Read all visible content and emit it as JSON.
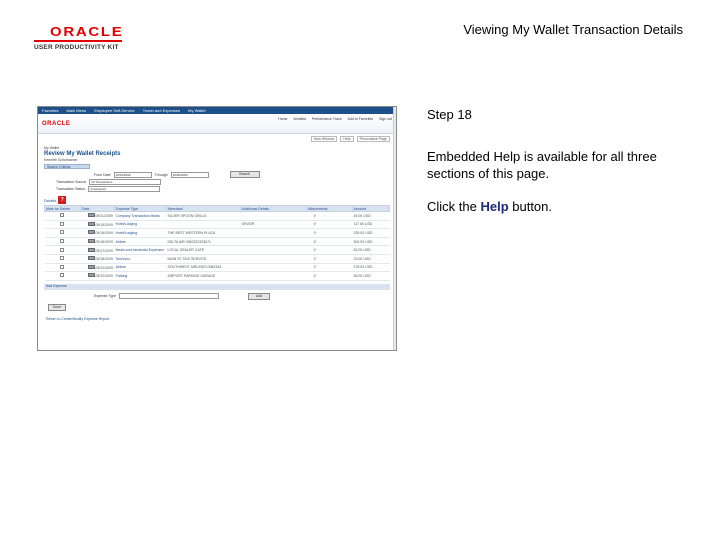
{
  "logo": {
    "name": "ORACLE",
    "subtitle": "USER PRODUCTIVITY KIT"
  },
  "header": {
    "title": "Viewing My Wallet Transaction Details"
  },
  "panel": {
    "step": "Step 18",
    "description": "Embedded Help is available for all three sections of this page.",
    "instruction_prefix": "Click the ",
    "instruction_keyword": "Help",
    "instruction_suffix": " button."
  },
  "screenshot": {
    "nav": [
      "Favorites",
      "Main Menu",
      "Employee Self-Service",
      "Travel and Expenses",
      "My Wallet"
    ],
    "brand": "ORACLE",
    "top_links": [
      "Home",
      "Worklist",
      "Performance Trace",
      "Add to Favorites",
      "Sign out"
    ],
    "util_links": [
      "New Window",
      "Help",
      "Personalize Page"
    ],
    "breadcrumb": "My Wallet",
    "page_heading": "Review My Wallet Receipts",
    "sub_heading": "Kenneth Schumacher",
    "search_section": "Search Criteria",
    "from_label": "From Date",
    "from_value": "10/01/2009",
    "through_label": "Through",
    "through_value": "10/06/2009",
    "search_button": "Search",
    "source_label": "Transaction Source",
    "source_value": "All Transactions",
    "status_label": "Transaction Status",
    "status_value": "Unassigned",
    "details_label": "Details",
    "help_icon_label": "?",
    "columns": [
      "Mark for Delete",
      "Date",
      "Expense Type",
      "Merchant",
      "Additional Details",
      "Attachments",
      "Amount"
    ],
    "rows": [
      {
        "date": "09/11/2009",
        "type": "Company Transaction Meals",
        "merchant": "SILVER SPOON GRILLE",
        "details": "",
        "amount": "45.00 USD"
      },
      {
        "date": "09/15/2009",
        "type": "Hotel/Lodging",
        "merchant": "",
        "details": "SEVIER",
        "amount": "117.60 USD"
      },
      {
        "date": "09/16/2009",
        "type": "Hotel/Lodging",
        "merchant": "THE BEST WESTERN PLAZA",
        "details": "",
        "amount": "325.00 USD"
      },
      {
        "date": "09/16/2009",
        "type": "Airfare",
        "merchant": "DELTA AIR 0082322333671",
        "details": "",
        "amount": "302.00 USD"
      },
      {
        "date": "09/17/2009",
        "type": "Meals and Incidental Expenses",
        "merchant": "LOCAL DEALER CAFE",
        "details": "",
        "amount": "63.00 USD"
      },
      {
        "date": "09/18/2009",
        "type": "Taxi/Limo",
        "merchant": "MAIN ST TAXI SERVICE",
        "details": "",
        "amount": "23.00 USD"
      },
      {
        "date": "09/22/2009",
        "type": "Airfare",
        "merchant": "SOUTHWEST AIRLINES 0082334",
        "details": "",
        "amount": "278.00 USD"
      },
      {
        "date": "09/22/2009",
        "type": "Parking",
        "merchant": "AIRPORT PARKING GARAGE",
        "details": "",
        "amount": "36.00 USD"
      }
    ],
    "add_section": "Add Expense",
    "expense_type_label": "Expense Type",
    "add_button": "Add",
    "done_button": "Done",
    "bottom_link": "Return to Create/Modify Expense Report"
  }
}
